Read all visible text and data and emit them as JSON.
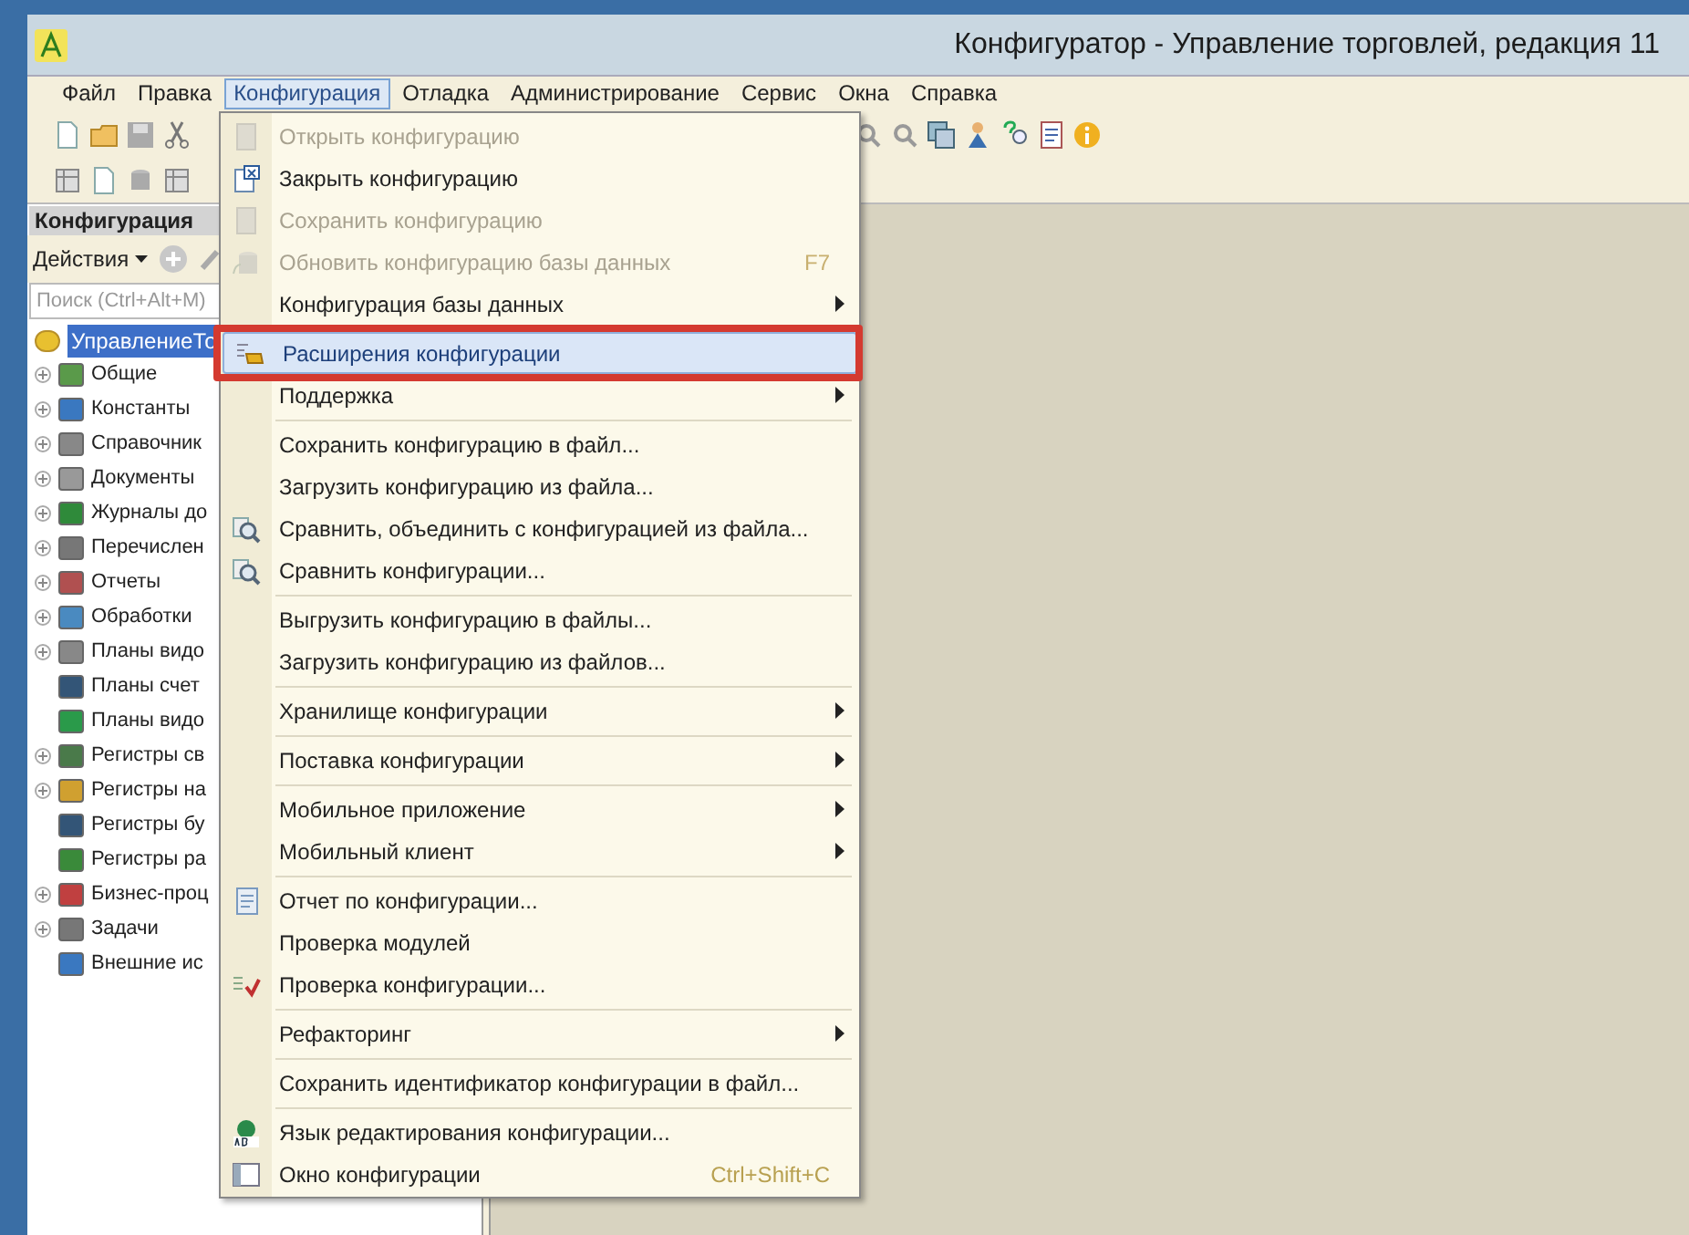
{
  "window": {
    "title": "Конфигуратор - Управление торговлей, редакция 11"
  },
  "menu_bar": [
    {
      "label": "Файл",
      "selected": false
    },
    {
      "label": "Правка",
      "selected": false
    },
    {
      "label": "Конфигурация",
      "selected": true
    },
    {
      "label": "Отладка",
      "selected": false
    },
    {
      "label": "Администрирование",
      "selected": false
    },
    {
      "label": "Сервис",
      "selected": false
    },
    {
      "label": "Окна",
      "selected": false
    },
    {
      "label": "Справка",
      "selected": false
    }
  ],
  "left_panel": {
    "title": "Конфигурация",
    "actions": "Действия",
    "search": {
      "placeholder": "Поиск (Ctrl+Alt+M)"
    },
    "tree": [
      {
        "label": "УправлениеТо",
        "selected": true,
        "children": [
          {
            "label": "Общие",
            "expandable": true
          },
          {
            "label": "Константы",
            "expandable": true
          },
          {
            "label": "Справочник",
            "expandable": true
          },
          {
            "label": "Документы",
            "expandable": true
          },
          {
            "label": "Журналы до",
            "expandable": true
          },
          {
            "label": "Перечислен",
            "expandable": true
          },
          {
            "label": "Отчеты",
            "expandable": true
          },
          {
            "label": "Обработки",
            "expandable": true
          },
          {
            "label": "Планы видо",
            "expandable": true
          },
          {
            "label": "Планы счет",
            "expandable": false
          },
          {
            "label": "Планы видо",
            "expandable": false
          },
          {
            "label": "Регистры св",
            "expandable": true
          },
          {
            "label": "Регистры на",
            "expandable": true
          },
          {
            "label": "Регистры бу",
            "expandable": false
          },
          {
            "label": "Регистры ра",
            "expandable": false
          },
          {
            "label": "Бизнес-проц",
            "expandable": true
          },
          {
            "label": "Задачи",
            "expandable": true
          },
          {
            "label": "Внешние ис",
            "expandable": false
          }
        ]
      }
    ]
  },
  "dropdown_menu": [
    {
      "kind": "item",
      "label": "Открыть конфигурацию",
      "disabled": true,
      "selected": false
    },
    {
      "kind": "item",
      "label": "Закрыть конфигурацию",
      "disabled": false,
      "selected": false
    },
    {
      "kind": "item",
      "label": "Сохранить конфигурацию",
      "disabled": true,
      "selected": false
    },
    {
      "kind": "item",
      "label": "Обновить конфигурацию базы данных",
      "disabled": true,
      "shortcut": "F7",
      "selected": false
    },
    {
      "kind": "item",
      "label": "Конфигурация базы данных",
      "disabled": false,
      "submenu": true,
      "selected": false
    },
    {
      "kind": "separator"
    },
    {
      "kind": "item",
      "label": "Расширения конфигурации",
      "disabled": false,
      "selected": true,
      "annotated": true
    },
    {
      "kind": "item",
      "label": "Поддержка",
      "disabled": false,
      "submenu": true,
      "selected": false
    },
    {
      "kind": "separator"
    },
    {
      "kind": "item",
      "label": "Сохранить конфигурацию в файл...",
      "disabled": false,
      "selected": false
    },
    {
      "kind": "item",
      "label": "Загрузить конфигурацию из файла...",
      "disabled": false,
      "selected": false
    },
    {
      "kind": "item",
      "label": "Сравнить, объединить с конфигурацией из файла...",
      "disabled": false,
      "selected": false
    },
    {
      "kind": "item",
      "label": "Сравнить конфигурации...",
      "disabled": false,
      "selected": false
    },
    {
      "kind": "separator"
    },
    {
      "kind": "item",
      "label": "Выгрузить конфигурацию в файлы...",
      "disabled": false,
      "selected": false
    },
    {
      "kind": "item",
      "label": "Загрузить конфигурацию из файлов...",
      "disabled": false,
      "selected": false
    },
    {
      "kind": "separator"
    },
    {
      "kind": "item",
      "label": "Хранилище конфигурации",
      "disabled": false,
      "submenu": true,
      "selected": false
    },
    {
      "kind": "separator"
    },
    {
      "kind": "item",
      "label": "Поставка конфигурации",
      "disabled": false,
      "submenu": true,
      "selected": false
    },
    {
      "kind": "separator"
    },
    {
      "kind": "item",
      "label": "Мобильное приложение",
      "disabled": false,
      "submenu": true,
      "selected": false
    },
    {
      "kind": "item",
      "label": "Мобильный клиент",
      "disabled": false,
      "submenu": true,
      "selected": false
    },
    {
      "kind": "separator"
    },
    {
      "kind": "item",
      "label": "Отчет по конфигурации...",
      "disabled": false,
      "selected": false
    },
    {
      "kind": "item",
      "label": "Проверка модулей",
      "disabled": false,
      "selected": false
    },
    {
      "kind": "item",
      "label": "Проверка конфигурации...",
      "disabled": false,
      "selected": false
    },
    {
      "kind": "separator"
    },
    {
      "kind": "item",
      "label": "Рефакторинг",
      "disabled": false,
      "submenu": true,
      "selected": false
    },
    {
      "kind": "separator"
    },
    {
      "kind": "item",
      "label": "Сохранить идентификатор конфигурации в файл...",
      "disabled": false,
      "selected": false
    },
    {
      "kind": "separator"
    },
    {
      "kind": "item",
      "label": "Язык редактирования конфигурации...",
      "disabled": false,
      "selected": false
    },
    {
      "kind": "item",
      "label": "Окно конфигурации",
      "disabled": false,
      "shortcut": "Ctrl+Shift+C",
      "selected": false
    }
  ]
}
